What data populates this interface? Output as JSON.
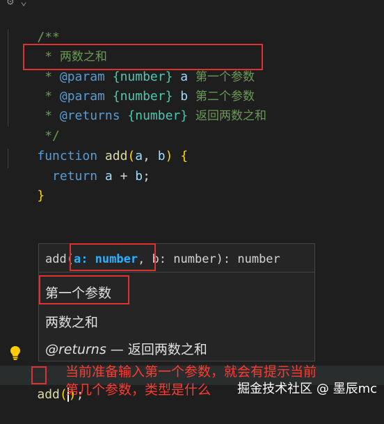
{
  "code": {
    "l1": "/**",
    "l2_star": " * ",
    "l2_text": "两数之和",
    "l3_star": " * ",
    "l3_tag": "@param",
    "l3_type": "{number}",
    "l3_name": "a",
    "l3_desc": "第一个参数",
    "l4_star": " * ",
    "l4_tag": "@param",
    "l4_type": "{number}",
    "l4_name": "b",
    "l4_desc": "第二个参数",
    "l5_star": " * ",
    "l5_tag": "@returns",
    "l5_type": "{number}",
    "l5_desc": "返回两数之和",
    "l6": " */",
    "l7_kw": "function",
    "l7_fn": "add",
    "l7_open": "(",
    "l7_a": "a",
    "l7_comma": ", ",
    "l7_b": "b",
    "l7_close": ")",
    "l7_brace": "{",
    "l8_kw": "return",
    "l8_a": "a",
    "l8_op": " + ",
    "l8_b": "b",
    "l8_semi": ";",
    "l9_brace": "}",
    "l13_fn": "add",
    "l13_open": "(",
    "l13_close": ")",
    "l13_semi": ";"
  },
  "signature_help": {
    "fn": "add(",
    "active_param": "a: number",
    "rest": ", b: number): number",
    "param_doc": "第一个参数",
    "summary": "两数之和",
    "returns_tag": "@returns",
    "returns_text": " — 返回两数之和"
  },
  "annotation": {
    "line1": "当前准备输入第一个参数，就会有提示当前",
    "line2": "第几个参数，类型是什么"
  },
  "watermark": "掘金技术社区 @ 墨辰mc",
  "icons": {
    "lightbulb": "lightbulb-icon",
    "top_partial": "settings-icon"
  },
  "colors": {
    "background": "#1e1e1e",
    "comment": "#6a9955",
    "keyword": "#569cd6",
    "function": "#dcdcaa",
    "type": "#4ec9b0",
    "bracket": "#ffd700",
    "highlight_box": "#e03131",
    "annotation": "#ff3b30"
  }
}
